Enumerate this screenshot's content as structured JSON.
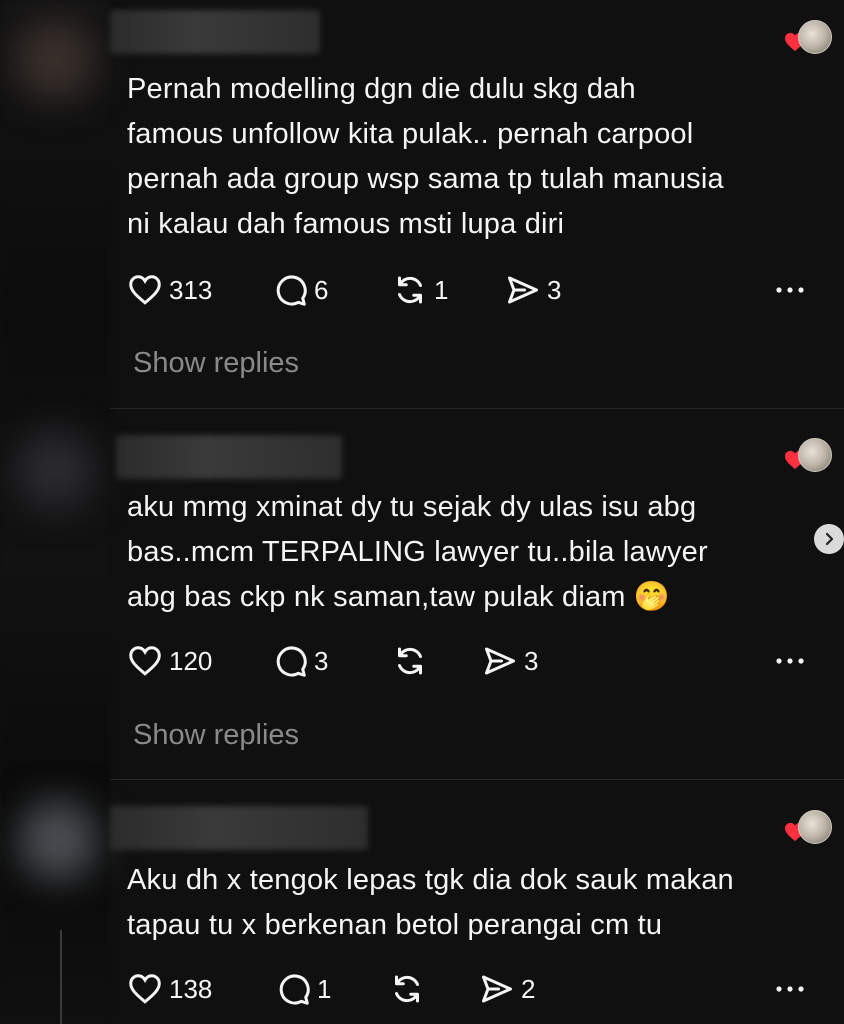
{
  "comments": [
    {
      "text": "Pernah modelling dgn die dulu skg dah famous unfollow kita pulak.. pernah carpool pernah ada group wsp sama tp tulah manusia ni kalau dah famous msti lupa diri",
      "lines": [
        "Pernah modelling dgn die dulu skg dah",
        "famous unfollow kita pulak.. pernah carpool",
        "pernah ada group wsp sama tp tulah manusia",
        "ni kalau dah famous msti lupa diri"
      ],
      "likes": "313",
      "replies": "6",
      "reposts": "1",
      "shares": "3",
      "show_replies": "Show replies"
    },
    {
      "text": "aku mmg xminat dy tu sejak dy ulas isu abg bas..mcm TERPALING lawyer tu..bila lawyer abg bas ckp nk saman,taw pulak diam 🤭",
      "lines": [
        "aku mmg xminat dy tu sejak dy ulas isu abg",
        "bas..mcm TERPALING lawyer tu..bila lawyer",
        "abg bas ckp nk saman,taw pulak diam 🤭"
      ],
      "likes": "120",
      "replies": "3",
      "reposts": "",
      "shares": "3",
      "show_replies": "Show replies"
    },
    {
      "text": "Aku dh x tengok lepas tgk dia dok sauk makan tapau tu x berkenan betol perangai cm tu",
      "lines": [
        "Aku dh x tengok lepas tgk dia dok sauk makan",
        "tapau tu x berkenan betol perangai cm tu"
      ],
      "likes": "138",
      "replies": "1",
      "reposts": "",
      "shares": "2"
    }
  ],
  "icons": {
    "like": "heart-outline-icon",
    "reply": "speech-bubble-icon",
    "repost": "repost-arrows-icon",
    "share": "send-icon",
    "more": "more-dots-icon",
    "creator_liked": "red-heart-icon"
  },
  "colors": {
    "background": "#101010",
    "text": "#f3f5f7",
    "muted": "#8a8a8a",
    "heart_red": "#ff3040"
  }
}
